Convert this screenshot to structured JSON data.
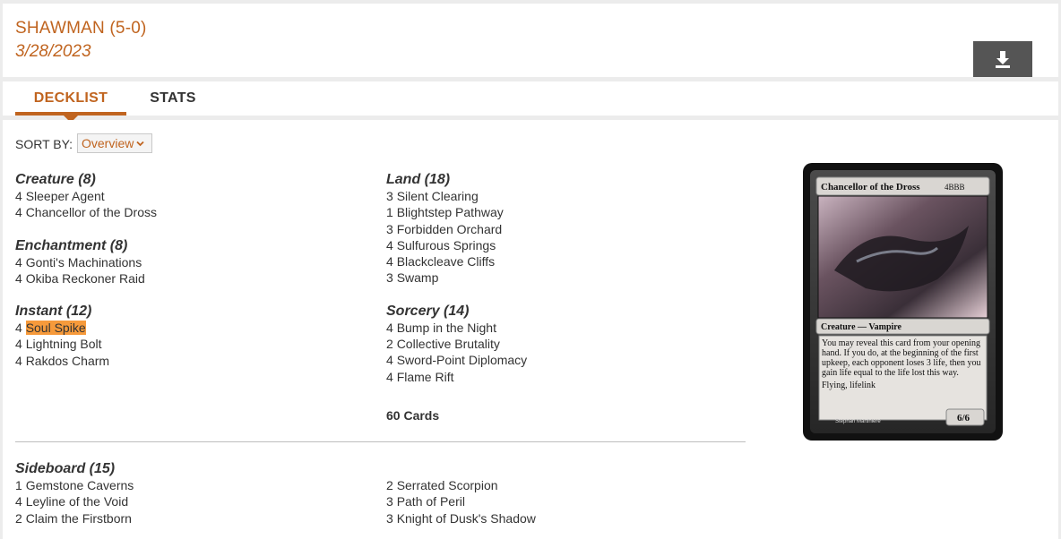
{
  "header": {
    "title": "SHAWMAN (5-0)",
    "date": "3/28/2023"
  },
  "tabs": [
    {
      "label": "DECKLIST",
      "active": true
    },
    {
      "label": "STATS",
      "active": false
    }
  ],
  "sort": {
    "label": "SORT BY:",
    "value": "Overview"
  },
  "deck": {
    "creature": {
      "title": "Creature (8)",
      "cards": [
        {
          "qty": "4",
          "name": "Sleeper Agent"
        },
        {
          "qty": "4",
          "name": "Chancellor of the Dross"
        }
      ]
    },
    "enchantment": {
      "title": "Enchantment (8)",
      "cards": [
        {
          "qty": "4",
          "name": "Gonti's Machinations"
        },
        {
          "qty": "4",
          "name": "Okiba Reckoner Raid"
        }
      ]
    },
    "instant": {
      "title": "Instant (12)",
      "cards": [
        {
          "qty": "4",
          "name": "Soul Spike"
        },
        {
          "qty": "4",
          "name": "Lightning Bolt"
        },
        {
          "qty": "4",
          "name": "Rakdos Charm"
        }
      ]
    },
    "land": {
      "title": "Land (18)",
      "cards": [
        {
          "qty": "3",
          "name": "Silent Clearing"
        },
        {
          "qty": "1",
          "name": "Blightstep Pathway"
        },
        {
          "qty": "3",
          "name": "Forbidden Orchard"
        },
        {
          "qty": "4",
          "name": "Sulfurous Springs"
        },
        {
          "qty": "4",
          "name": "Blackcleave Cliffs"
        },
        {
          "qty": "3",
          "name": "Swamp"
        }
      ]
    },
    "sorcery": {
      "title": "Sorcery (14)",
      "cards": [
        {
          "qty": "4",
          "name": "Bump in the Night"
        },
        {
          "qty": "2",
          "name": "Collective Brutality"
        },
        {
          "qty": "4",
          "name": "Sword-Point Diplomacy"
        },
        {
          "qty": "4",
          "name": "Flame Rift"
        }
      ]
    },
    "total": "60 Cards"
  },
  "sideboard": {
    "title": "Sideboard (15)",
    "left": [
      {
        "qty": "1",
        "name": "Gemstone Caverns"
      },
      {
        "qty": "4",
        "name": "Leyline of the Void"
      },
      {
        "qty": "2",
        "name": "Claim the Firstborn"
      }
    ],
    "right": [
      {
        "qty": "2",
        "name": "Serrated Scorpion"
      },
      {
        "qty": "3",
        "name": "Path of Peril"
      },
      {
        "qty": "3",
        "name": "Knight of Dusk's Shadow"
      }
    ]
  },
  "preview_card": {
    "name": "Chancellor of the Dross",
    "mana_cost": "4BBB",
    "type_line": "Creature — Vampire",
    "rules_text": "You may reveal this card from your opening hand. If you do, at the beginning of the first upkeep, each opponent loses 3 life, then you gain life equal to the life lost this way.",
    "keywords": "Flying, lifelink",
    "pt": "6/6",
    "artist": "Stephan Martiniere"
  },
  "icons": {
    "download": "download-icon",
    "chevron": "chevron-down-icon"
  },
  "colors": {
    "accent": "#c0641f",
    "highlight": "#f69a3b",
    "button": "#555555"
  }
}
